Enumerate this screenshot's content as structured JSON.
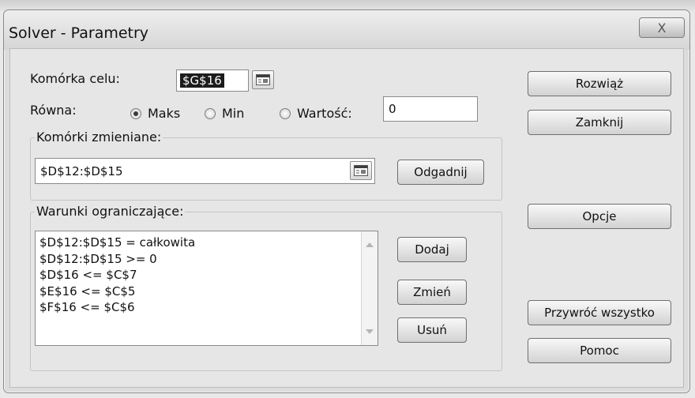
{
  "window": {
    "title": "Solver - Parametry",
    "close_glyph": "X"
  },
  "target": {
    "label": "Komórka celu:",
    "value": "$G$16"
  },
  "equal_to": {
    "label": "Równa:",
    "options": [
      {
        "label": "Maks",
        "selected": true
      },
      {
        "label": "Min",
        "selected": false
      },
      {
        "label": "Wartość:",
        "selected": false
      }
    ],
    "value_input": "0"
  },
  "changing_cells": {
    "label": "Komórki zmieniane:",
    "value": "$D$12:$D$15",
    "guess_button": "Odgadnij"
  },
  "constraints": {
    "label": "Warunki ograniczające:",
    "items": [
      "$D$12:$D$15 = całkowita",
      "$D$12:$D$15 >= 0",
      "$D$16 <= $C$7",
      "$E$16 <= $C$5",
      "$F$16 <= $C$6"
    ],
    "buttons": {
      "add": "Dodaj",
      "change": "Zmień",
      "delete": "Usuń"
    }
  },
  "side_buttons": {
    "solve": "Rozwiąż",
    "close": "Zamknij",
    "options": "Opcje",
    "reset_all": "Przywróć wszystko",
    "help": "Pomoc"
  },
  "icons": {
    "refedit": "range-select-icon",
    "close": "close-icon"
  }
}
